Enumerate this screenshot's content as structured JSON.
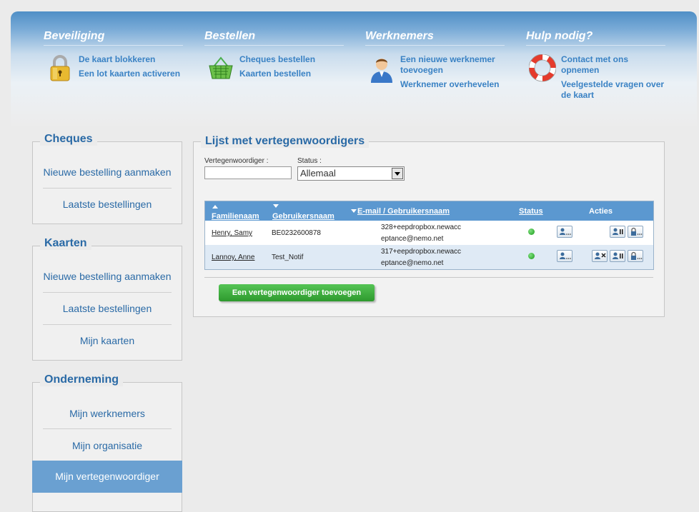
{
  "menu": [
    {
      "title": "Beveiliging",
      "icon": "padlock-icon",
      "links": [
        "De kaart blokkeren",
        "Een lot kaarten activeren"
      ]
    },
    {
      "title": "Bestellen",
      "icon": "basket-icon",
      "links": [
        "Cheques bestellen",
        "Kaarten bestellen"
      ]
    },
    {
      "title": "Werknemers",
      "icon": "person-icon",
      "links": [
        "Een nieuwe werknemer toevoegen",
        "Werknemer overhevelen"
      ]
    },
    {
      "title": "Hulp nodig?",
      "icon": "lifebuoy-icon",
      "links": [
        "Contact met ons opnemen",
        "Veelgestelde vragen over de kaart"
      ]
    }
  ],
  "sidebar": {
    "cheques": {
      "title": "Cheques",
      "items": [
        "Nieuwe bestelling aanmaken",
        "Laatste bestellingen"
      ]
    },
    "kaarten": {
      "title": "Kaarten",
      "items": [
        "Nieuwe bestelling aanmaken",
        "Laatste bestellingen",
        "Mijn kaarten"
      ]
    },
    "onderneming": {
      "title": "Onderneming",
      "items": [
        "Mijn werknemers",
        "Mijn organisatie",
        "Mijn vertegenwoordiger"
      ]
    }
  },
  "main": {
    "title": "Lijst met vertegenwoordigers",
    "filter": {
      "rep_label": "Vertegenwoordiger :",
      "rep_value": "",
      "status_label": "Status :",
      "status_value": "Allemaal"
    },
    "table": {
      "headers": [
        "Familienaam",
        "Gebruikersnaam",
        "E-mail / Gebruikersnaam",
        "Status",
        "Acties"
      ],
      "rows": [
        {
          "name": "Henry, Samy",
          "username": "BE0232600878",
          "email1": "328+eepdropbox.newacc",
          "email2": "eptance@nemo.net",
          "status": "active",
          "actions": [
            "view-user-icon",
            "pause-user-icon",
            "lock-icon"
          ]
        },
        {
          "name": "Lannoy, Anne",
          "username": "Test_Notif",
          "email1": "317+eepdropbox.newacc",
          "email2": "eptance@nemo.net",
          "status": "active",
          "actions": [
            "view-user-icon",
            "delete-user-icon",
            "pause-user-icon",
            "lock-icon"
          ]
        }
      ]
    },
    "add_button": "Een vertegenwoordiger toevoegen"
  },
  "colors": {
    "accent": "#2a6aa6",
    "link": "#3a82c4",
    "header_bg": "#5b98d0",
    "active_nav": "#6aa0d1",
    "button_green": "#3aa83a",
    "status_green": "#22aa22"
  }
}
